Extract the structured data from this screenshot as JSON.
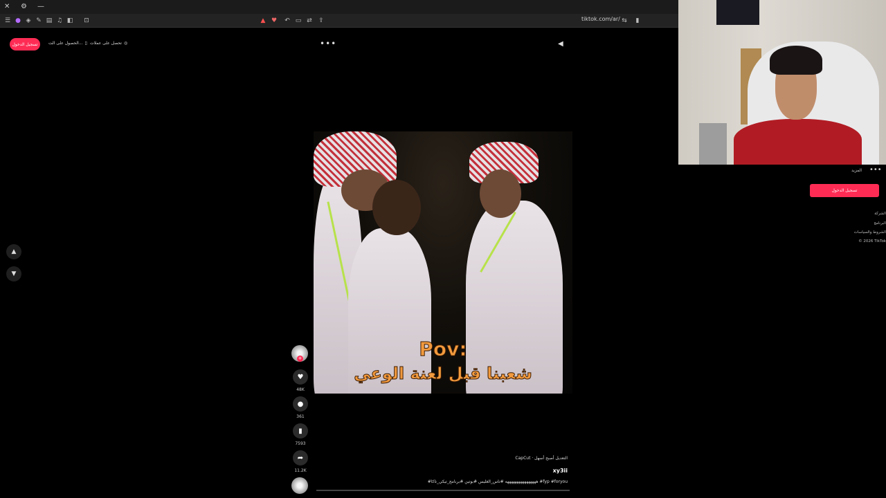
{
  "browser": {
    "url": "tiktok.com/ar/",
    "window_controls": [
      "✕",
      "⚙",
      "—"
    ]
  },
  "top": {
    "login_label": "تسجيل الدخول",
    "get_app_label": "الحصول على الت...",
    "get_coins_label": "تحصل على عملات"
  },
  "video": {
    "caption_pov": "Pov:",
    "caption_ar": "شعبنا قبل لعنة الوعي",
    "progress": 0.0
  },
  "actions": {
    "likes": "48K",
    "comments": "361",
    "saves": "7593",
    "shares": "11.2K"
  },
  "post": {
    "capcut_label": "CapCut · التعديل أصبح أسهل",
    "username": "xy3ii",
    "description": "#ههههههههههههههههه #تأس_الغليس #بوتين #برنامج_تيكي_تاكا #fyp #foryou"
  },
  "sidebar": {
    "more_label": "المزيد",
    "login_label": "تسجيل الدخول",
    "links": [
      "الشركة",
      "البرنامج",
      "الشروط والسياسات",
      "© 2026 TikTok"
    ]
  },
  "colors": {
    "accent": "#fe2c55",
    "background": "#000000"
  }
}
